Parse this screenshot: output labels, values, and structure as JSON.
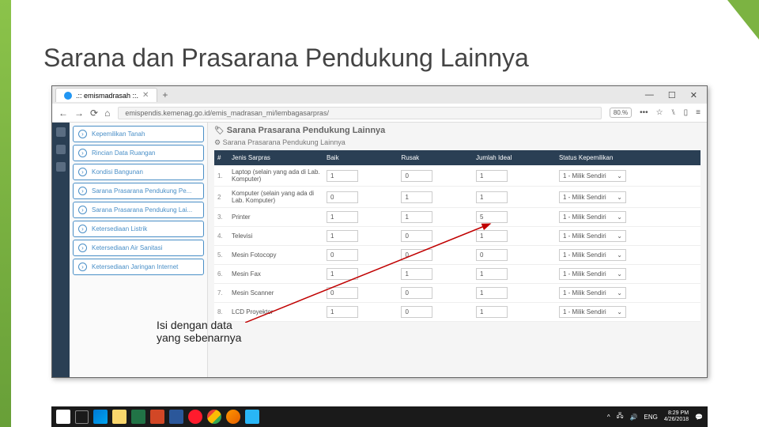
{
  "slide": {
    "title": "Sarana dan Prasarana Pendukung Lainnya"
  },
  "browser": {
    "tab_title": ".:: emismadrasah ::.",
    "tab_add": "+",
    "win": {
      "min": "—",
      "max": "☐",
      "close": "✕"
    },
    "nav": {
      "back": "←",
      "fwd": "→",
      "reload": "⟳",
      "home": "⌂"
    },
    "url": "emispendis.kemenag.go.id/emis_madrasan_mi/lembagasarpras/",
    "zoom": "80.%",
    "more": "•••",
    "star": "☆"
  },
  "sidebar": {
    "items": [
      {
        "label": "Kepemilikan Tanah"
      },
      {
        "label": "Rincian Data Ruangan"
      },
      {
        "label": "Kondisi Bangunan"
      },
      {
        "label": "Sarana Prasarana Pendukung Pe..."
      },
      {
        "label": "Sarana Prasarana Pendukung Lai..."
      },
      {
        "label": "Ketersediaan Listrik"
      },
      {
        "label": "Ketersediaan Air Sanitasi"
      },
      {
        "label": "Ketersediaan Jaringan Internet"
      }
    ]
  },
  "page": {
    "tag": "🏷",
    "title": "Sarana Prasarana Pendukung Lainnya",
    "section_icon": "⚙",
    "section": "Sarana Prasarana Pendukung Lainnya",
    "cols": {
      "num": "#",
      "name": "Jenis Sarpras",
      "baik": "Baik",
      "rusak": "Rusak",
      "ideal": "Jumlah Ideal",
      "status": "Status Kepemilikan"
    },
    "rows": [
      {
        "n": "1.",
        "name": "Laptop (selain yang ada di Lab. Komputer)",
        "baik": "1",
        "rusak": "0",
        "ideal": "1",
        "status": "1 - Milik Sendiri"
      },
      {
        "n": "2",
        "name": "Komputer (selain yang ada di Lab. Komputer)",
        "baik": "0",
        "rusak": "1",
        "ideal": "1",
        "status": "1 - Milik Sendiri"
      },
      {
        "n": "3.",
        "name": "Printer",
        "baik": "1",
        "rusak": "1",
        "ideal": "5",
        "status": "1 - Milik Sendiri"
      },
      {
        "n": "4.",
        "name": "Televisi",
        "baik": "1",
        "rusak": "0",
        "ideal": "1",
        "status": "1 - Milik Sendiri"
      },
      {
        "n": "5.",
        "name": "Mesin Fotocopy",
        "baik": "0",
        "rusak": "0",
        "ideal": "0",
        "status": "1 - Milik Sendiri"
      },
      {
        "n": "6.",
        "name": "Mesin Fax",
        "baik": "1",
        "rusak": "1",
        "ideal": "1",
        "status": "1 - Milik Sendiri"
      },
      {
        "n": "7.",
        "name": "Mesin Scanner",
        "baik": "0",
        "rusak": "0",
        "ideal": "1",
        "status": "1 - Milik Sendiri"
      },
      {
        "n": "8.",
        "name": "LCD Proyektor",
        "baik": "1",
        "rusak": "0",
        "ideal": "1",
        "status": "1 - Milik Sendiri"
      }
    ]
  },
  "annotation": {
    "line1": "Isi dengan data",
    "line2": "yang sebenarnya"
  },
  "taskbar": {
    "tray": {
      "up": "^",
      "net": "🖧",
      "snd": "🔊",
      "lang": "ENG",
      "time": "8:29 PM",
      "date": "4/26/2018",
      "notif": "💬"
    }
  }
}
